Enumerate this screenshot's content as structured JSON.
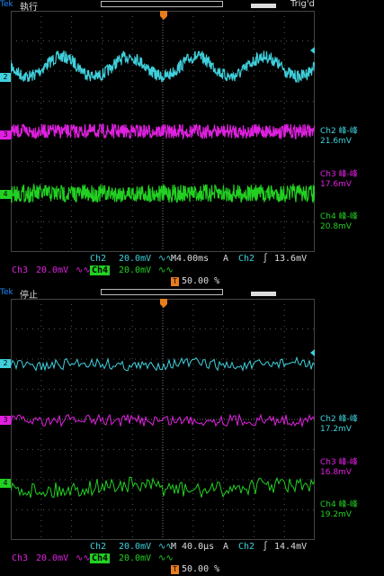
{
  "brand": "Tek",
  "colors": {
    "ch2": "#3fd0dc",
    "ch3": "#e020e0",
    "ch4": "#22d022",
    "trigger": "#e87d1e",
    "grid": "#555555",
    "brand": "#1a8cff"
  },
  "panels": [
    {
      "state": "執行",
      "trig_status": "Trig'd",
      "channel_markers": [
        "2",
        "3",
        "4"
      ],
      "measurements": [
        {
          "label": "Ch2 峰-峰",
          "value": "21.6mV"
        },
        {
          "label": "Ch3 峰-峰",
          "value": "17.6mV"
        },
        {
          "label": "Ch4 峰-峰",
          "value": "20.8mV"
        }
      ],
      "footer": {
        "ch2": "Ch2",
        "ch2_scale": "20.0mV",
        "ch3": "Ch3",
        "ch3_scale": "20.0mV",
        "ch4": "Ch4",
        "ch4_scale": "20.0mV",
        "timebase": "M4.00ms",
        "trigger_mode": "A",
        "trigger_source": "Ch2",
        "trigger_level": "13.6mV",
        "trigger_position": "50.00 %"
      }
    },
    {
      "state": "停止",
      "trig_status": "",
      "channel_markers": [
        "2",
        "3",
        "4"
      ],
      "measurements": [
        {
          "label": "Ch2 峰-峰",
          "value": "17.2mV"
        },
        {
          "label": "Ch3 峰-峰",
          "value": "16.8mV"
        },
        {
          "label": "Ch4 峰-峰",
          "value": "19.2mV"
        }
      ],
      "footer": {
        "ch2": "Ch2",
        "ch2_scale": "20.0mV",
        "ch3": "Ch3",
        "ch3_scale": "20.0mV",
        "ch4": "Ch4",
        "ch4_scale": "20.0mV",
        "timebase": "M 40.0µs",
        "trigger_mode": "A",
        "trigger_source": "Ch2",
        "trigger_level": "14.4mV",
        "trigger_position": "50.00 %"
      }
    }
  ]
}
